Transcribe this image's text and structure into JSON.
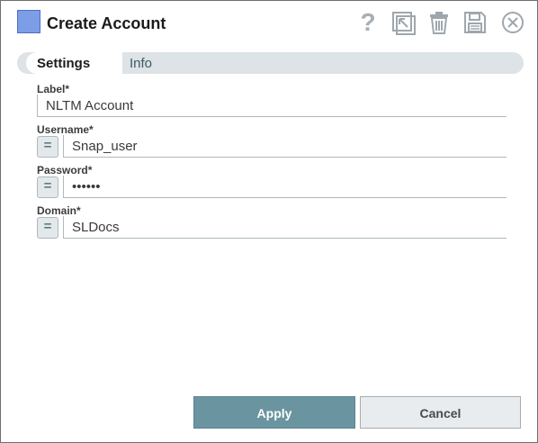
{
  "dialog": {
    "title": "Create Account",
    "accent_color": "#7c9ee6",
    "toolbar_icons": [
      "help-icon",
      "export-icon",
      "delete-icon",
      "save-icon",
      "close-icon"
    ]
  },
  "tabs": [
    {
      "label": "Settings",
      "active": true
    },
    {
      "label": "Info",
      "active": false
    }
  ],
  "fields": {
    "label": {
      "label": "Label*",
      "value": "NLTM Account"
    },
    "username": {
      "label": "Username*",
      "value": "Snap_user",
      "expression_button": "="
    },
    "password": {
      "label": "Password*",
      "value": "••••••",
      "expression_button": "="
    },
    "domain": {
      "label": "Domain*",
      "value": "SLDocs",
      "expression_button": "="
    }
  },
  "buttons": {
    "apply": "Apply",
    "cancel": "Cancel"
  },
  "colors": {
    "apply_bg": "#6a94a0",
    "cancel_bg": "#e9ecee",
    "icon_gray": "#9fa7ad"
  }
}
